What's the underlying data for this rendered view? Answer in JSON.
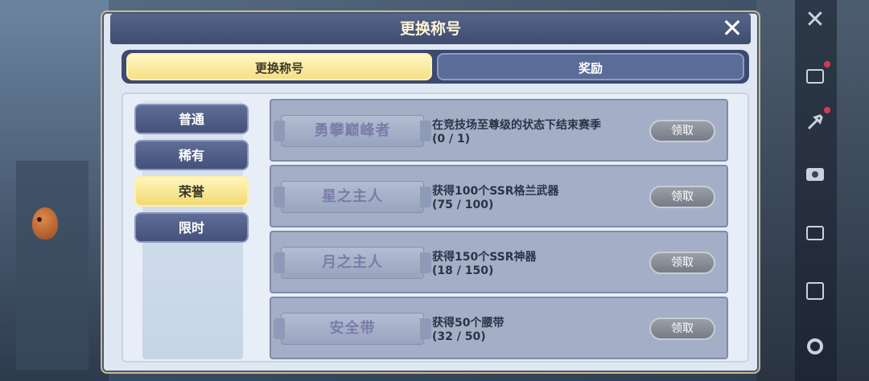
{
  "dialog": {
    "title": "更换称号",
    "close_label": "✕"
  },
  "tabs": [
    {
      "label": "更换称号",
      "active": true
    },
    {
      "label": "奖励",
      "active": false
    }
  ],
  "categories": [
    {
      "label": "普通",
      "active": false
    },
    {
      "label": "稀有",
      "active": false
    },
    {
      "label": "荣誉",
      "active": true
    },
    {
      "label": "限时",
      "active": false
    }
  ],
  "titles": [
    {
      "name": "勇攀巅峰者",
      "description": "在竞技场至尊级的状态下结束赛季",
      "progress": "(0 / 1)",
      "button": "领取"
    },
    {
      "name": "星之主人",
      "description": "获得100个SSR格兰武器",
      "progress": "(75 / 100)",
      "button": "领取"
    },
    {
      "name": "月之主人",
      "description": "获得150个SSR神器",
      "progress": "(18 / 150)",
      "button": "领取"
    },
    {
      "name": "安全带",
      "description": "获得50个腰带",
      "progress": "(32 / 50)",
      "button": "领取"
    }
  ],
  "hud": {
    "close_label": "✕",
    "icons": [
      "close-icon",
      "card-icon",
      "tools-icon",
      "camera-icon",
      "battery-icon",
      "calendar-icon",
      "gear-icon"
    ]
  },
  "colors": {
    "tab_active": "#f6df84",
    "tab_inactive": "#5c6c98",
    "card": "#a4afc7",
    "claim_button": "#767c87",
    "header": "#3f4c6e"
  }
}
